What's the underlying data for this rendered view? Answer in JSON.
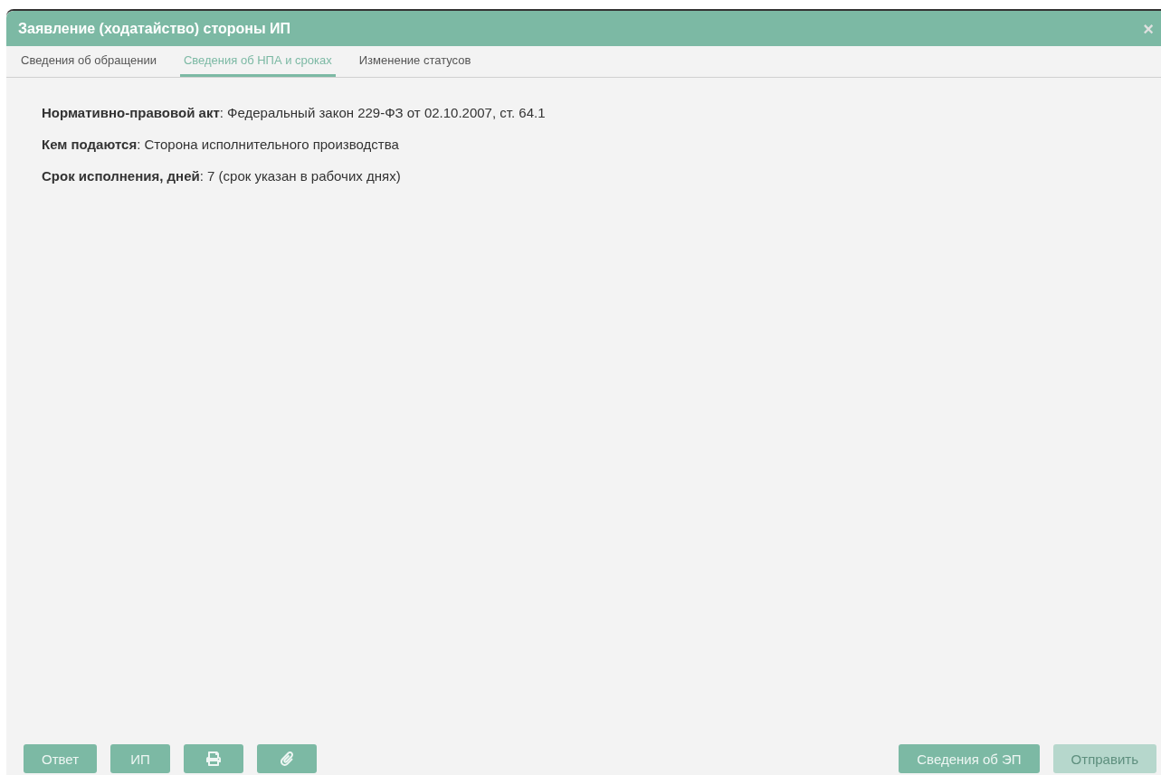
{
  "window": {
    "title": "Заявление (ходатайство) стороны ИП",
    "close": "×"
  },
  "tabs": [
    {
      "label": "Сведения об обращении",
      "selected": false
    },
    {
      "label": "Сведения об НПА и сроках",
      "selected": true
    },
    {
      "label": "Изменение статусов",
      "selected": false
    }
  ],
  "details": [
    "**Нормативно-правовой акт**: Федеральный закон 229-ФЗ от 02.10.2007, ст. 64.1",
    "**Кем подаются**: Сторона исполнительного производства",
    "**Срок исполнения, дней**: 7 (срок указан в рабочих днях)"
  ],
  "left_buttons": [
    {
      "kind": "text",
      "label": "Ответ",
      "disabled": false
    },
    {
      "kind": "text",
      "label": "ИП",
      "disabled": false
    },
    {
      "kind": "print",
      "disabled": false
    },
    {
      "kind": "attach",
      "disabled": false
    }
  ],
  "right_buttons": [
    {
      "kind": "text",
      "label": "Сведения об ЭП",
      "disabled": false
    },
    {
      "kind": "text",
      "label": "Отправить",
      "disabled": true
    }
  ]
}
